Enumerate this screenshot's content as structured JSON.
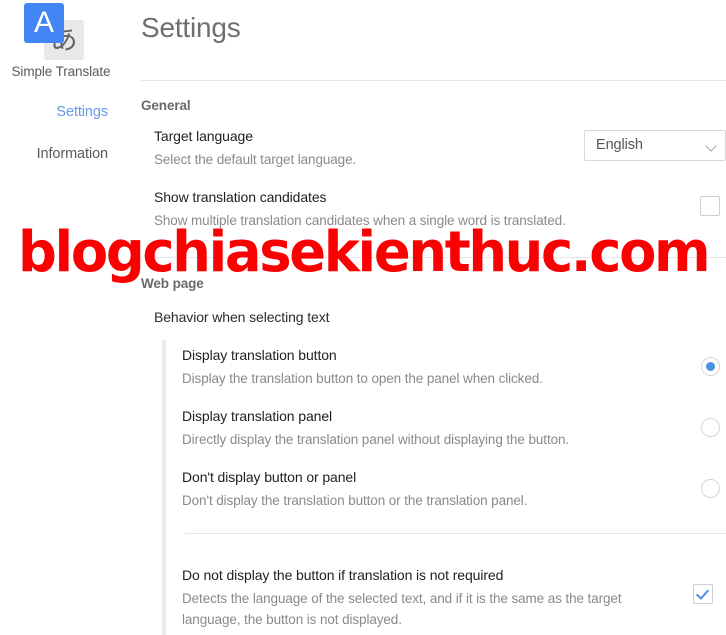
{
  "sidebar": {
    "logo": {
      "primary_glyph": "A",
      "secondary_glyph": "あ",
      "primary_color": "#4285f4",
      "secondary_color": "#e8e8e8"
    },
    "brand": "Simple Translate",
    "items": [
      {
        "label": "Settings",
        "active": true
      },
      {
        "label": "Information",
        "active": false
      }
    ]
  },
  "header": {
    "title": "Settings"
  },
  "sections": [
    {
      "id": "general",
      "title": "General",
      "rows": [
        {
          "title": "Target language",
          "desc": "Select the default target language.",
          "control": "select",
          "value": "English"
        },
        {
          "title": "Show translation candidates",
          "desc": "Show multiple translation candidates when a single word is translated.",
          "control": "checkbox",
          "checked": false
        }
      ]
    },
    {
      "id": "web-page",
      "title": "Web page",
      "subsection": "Behavior when selecting text",
      "radios": [
        {
          "title": "Display translation button",
          "desc": "Display the translation button to open the panel when clicked.",
          "selected": true
        },
        {
          "title": "Display translation panel",
          "desc": "Directly display the translation panel without displaying the button.",
          "selected": false
        },
        {
          "title": "Don't display button or panel",
          "desc": "Don't display the translation button or the translation panel.",
          "selected": false
        }
      ],
      "extra": {
        "title": "Do not display the button if translation is not required",
        "desc": "Detects the language of the selected text, and if it is the same as the target language, the button is not displayed.",
        "control": "checkbox",
        "checked": true
      }
    }
  ],
  "watermark": {
    "text": "blogchiasekienthuc.com",
    "color": "#fb0000"
  },
  "colors": {
    "accent": "#4a90e2",
    "link": "#6699e8",
    "muted": "#8a8a8a",
    "divider": "#e7e7e7"
  }
}
